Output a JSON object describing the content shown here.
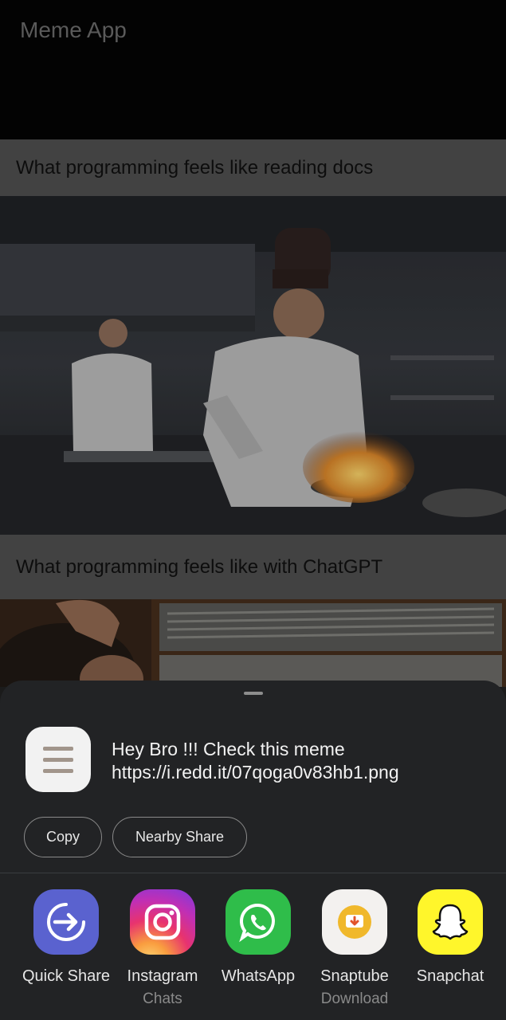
{
  "app": {
    "title": "Meme App",
    "memes": [
      {
        "caption": "What programming feels like reading docs",
        "image_icon": "chef-kitchen-photo"
      },
      {
        "caption": "What programming feels like with ChatGPT",
        "image_icon": "man-holding-head-photo"
      }
    ]
  },
  "share_sheet": {
    "message_line1": "Hey Bro !!! Check this meme",
    "message_line2": "https://i.redd.it/07qoga0v83hb1.png",
    "actions": {
      "copy": "Copy",
      "nearby_share": "Nearby Share"
    },
    "targets": [
      {
        "label": "Quick Share",
        "sub": "",
        "icon": "quick-share-icon"
      },
      {
        "label": "Instagram",
        "sub": "Chats",
        "icon": "instagram-icon"
      },
      {
        "label": "WhatsApp",
        "sub": "",
        "icon": "whatsapp-icon"
      },
      {
        "label": "Snaptube",
        "sub": "Download",
        "icon": "snaptube-icon"
      },
      {
        "label": "Snapchat",
        "sub": "",
        "icon": "snapchat-icon"
      }
    ]
  },
  "colors": {
    "sheet_bg": "#222325",
    "scrim_caption_bg": "#424242",
    "quick_share": "#5a62cf",
    "whatsapp": "#2fbd4a",
    "snapchat": "#fff62b"
  }
}
